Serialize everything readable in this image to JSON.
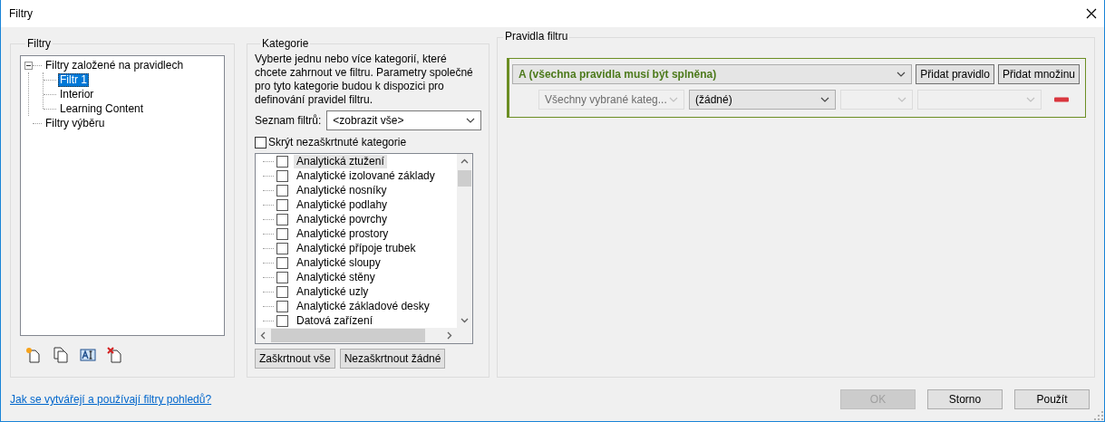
{
  "window": {
    "title": "Filtry"
  },
  "filters_panel": {
    "title": "Filtry",
    "tree": [
      {
        "label": "Filtry založené na pravidlech",
        "expanded": true,
        "selected": false,
        "children": [
          {
            "label": "Filtr 1",
            "selected": true
          },
          {
            "label": "Interior",
            "selected": false
          },
          {
            "label": "Learning Content",
            "selected": false
          }
        ]
      },
      {
        "label": "Filtry výběru",
        "selected": false
      }
    ]
  },
  "categories_panel": {
    "title": "Kategorie",
    "description": "Vyberte jednu nebo více kategorií, které chcete zahrnout ve filtru. Parametry společné pro tyto kategorie budou k dispozici pro definování pravidel filtru.",
    "filter_list_label": "Seznam filtrů:",
    "filter_list_value": "<zobrazit vše>",
    "hide_unchecked": {
      "label": "Skrýt nezaškrtnuté kategorie",
      "checked": false
    },
    "items": [
      {
        "label": "Analytická ztužení",
        "checked": false,
        "selected": true
      },
      {
        "label": "Analytické izolované základy",
        "checked": false,
        "selected": false
      },
      {
        "label": "Analytické nosníky",
        "checked": false,
        "selected": false
      },
      {
        "label": "Analytické podlahy",
        "checked": false,
        "selected": false
      },
      {
        "label": "Analytické povrchy",
        "checked": false,
        "selected": false
      },
      {
        "label": "Analytické prostory",
        "checked": false,
        "selected": false
      },
      {
        "label": "Analytické přípoje trubek",
        "checked": false,
        "selected": false
      },
      {
        "label": "Analytické sloupy",
        "checked": false,
        "selected": false
      },
      {
        "label": "Analytické stěny",
        "checked": false,
        "selected": false
      },
      {
        "label": "Analytické uzly",
        "checked": false,
        "selected": false
      },
      {
        "label": "Analytické základové desky",
        "checked": false,
        "selected": false
      },
      {
        "label": "Datová zařízení",
        "checked": false,
        "selected": false
      }
    ],
    "buttons": [
      "Zaškrtnout vše",
      "Nezaškrtnout žádné"
    ]
  },
  "rules_panel": {
    "title": "Pravidla filtru",
    "group": {
      "value": "A (všechna pravidla musí být splněna)",
      "buttons": [
        "Přidat pravidlo",
        "Přidat množinu"
      ]
    },
    "rules": [
      {
        "fields": [
          {
            "value": "Všechny vybrané kateg...",
            "disabled": true
          },
          {
            "value": "(žádné)",
            "disabled": false
          },
          {
            "disabled": true
          },
          {
            "disabled": true
          }
        ]
      }
    ]
  },
  "help_link": "Jak se vytvářejí a používají filtry pohledů?",
  "buttons": [
    {
      "label": "OK",
      "disabled": true
    },
    {
      "label": "Storno",
      "disabled": false
    },
    {
      "label": "Použít",
      "disabled": false
    }
  ]
}
